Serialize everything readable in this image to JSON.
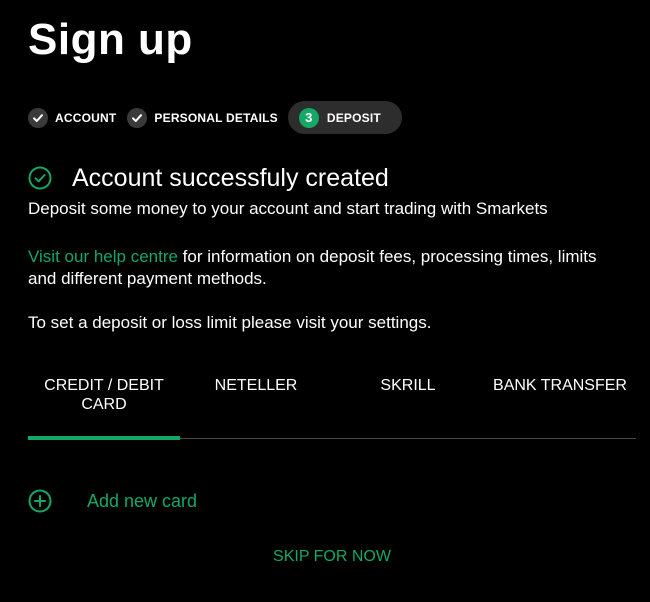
{
  "page": {
    "title": "Sign up"
  },
  "stepper": {
    "steps": [
      {
        "label": "ACCOUNT",
        "state": "done"
      },
      {
        "label": "PERSONAL DETAILS",
        "state": "done"
      },
      {
        "label": "DEPOSIT",
        "state": "active",
        "number": "3"
      }
    ]
  },
  "status": {
    "heading": "Account successfuly created",
    "message": "Deposit some money to your account and start trading with Smarkets"
  },
  "help": {
    "link_text": "Visit our help centre",
    "text": " for information on deposit fees, processing times, limits and different payment methods."
  },
  "limits": {
    "text": "To set a deposit or loss limit please visit your settings."
  },
  "tabs": [
    {
      "label": "CREDIT / DEBIT CARD",
      "active": true
    },
    {
      "label": "NETELLER",
      "active": false
    },
    {
      "label": "SKRILL",
      "active": false
    },
    {
      "label": "BANK TRANSFER",
      "active": false
    }
  ],
  "card": {
    "add_label": "Add new card"
  },
  "skip": {
    "label": "SKIP FOR NOW"
  },
  "colors": {
    "background": "#000000",
    "accent": "#14a866",
    "step_bg": "#3a3a3a",
    "active_step_bg": "#2d2d2d",
    "divider": "#4a4a4a"
  },
  "icons": {
    "step_done": "check-icon",
    "success": "check-circle-icon",
    "add": "plus-circle-icon"
  }
}
